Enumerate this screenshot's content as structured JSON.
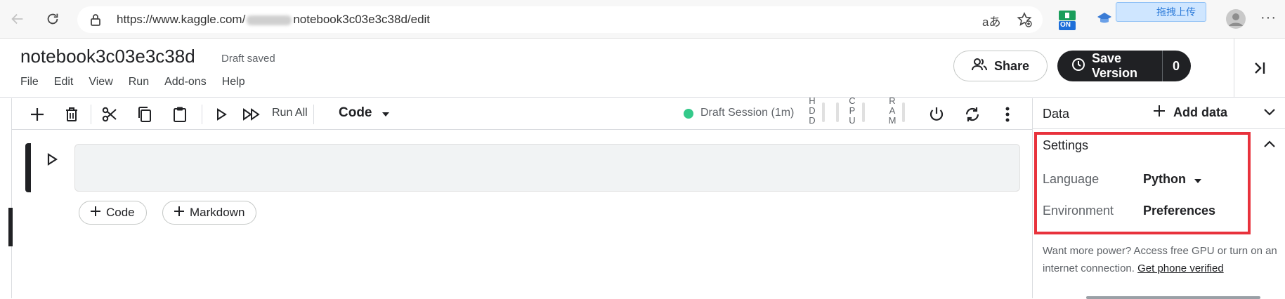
{
  "browser": {
    "url_prefix": "https://www.kaggle.com/",
    "url_suffix": "notebook3c03e3c38d/edit",
    "ext_badge": "ON",
    "upload_tip": "拖拽上传",
    "more": "···",
    "translate": "aあ"
  },
  "notebook": {
    "title": "notebook3c03e3c38d",
    "status": "Draft saved"
  },
  "menu": [
    "File",
    "Edit",
    "View",
    "Run",
    "Add-ons",
    "Help"
  ],
  "header": {
    "share_label": "Share",
    "save_label": "Save Version",
    "save_count": "0"
  },
  "toolbar": {
    "run_all_label": "Run All",
    "cell_type": "Code",
    "session_text": "Draft Session (1m)",
    "session_color": "#34c98a",
    "meters": [
      "HDD",
      "CPU",
      "RAM"
    ]
  },
  "cell_actions": {
    "add_code": "Code",
    "add_markdown": "Markdown"
  },
  "right_panel": {
    "data_label": "Data",
    "add_data_label": "Add data",
    "settings_label": "Settings",
    "language_label": "Language",
    "language_value": "Python",
    "environment_label": "Environment",
    "environment_value": "Preferences",
    "power_note": "Want more power? Access free GPU or turn on an internet connection.",
    "phone_link": "Get phone verified",
    "highlight_color": "#e8323c"
  }
}
